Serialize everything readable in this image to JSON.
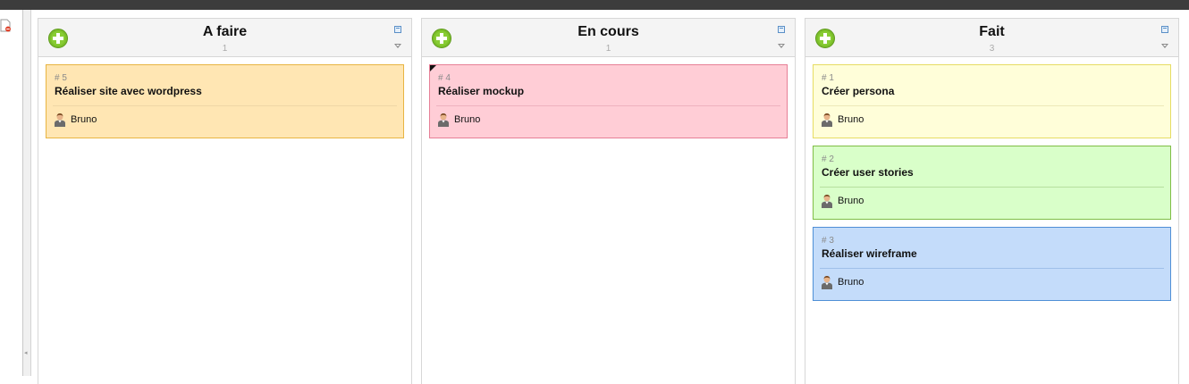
{
  "board": {
    "columns": [
      {
        "title": "A faire",
        "count": "1",
        "cards": [
          {
            "id": "# 5",
            "title": "Réaliser site avec wordpress",
            "assignee": "Bruno",
            "color": "#ffe6b3",
            "border": "#e8b442",
            "separator": "#efd7a6",
            "flagged": false
          }
        ]
      },
      {
        "title": "En cours",
        "count": "1",
        "cards": [
          {
            "id": "# 4",
            "title": "Réaliser mockup",
            "assignee": "Bruno",
            "color": "#ffcdd6",
            "border": "#e67f96",
            "separator": "#eeb2bf",
            "flagged": true
          }
        ]
      },
      {
        "title": "Fait",
        "count": "3",
        "cards": [
          {
            "id": "# 1",
            "title": "Créer persona",
            "assignee": "Bruno",
            "color": "#fffed9",
            "border": "#e6dc63",
            "separator": "#ece9b9",
            "flagged": false
          },
          {
            "id": "# 2",
            "title": "Créer user stories",
            "assignee": "Bruno",
            "color": "#d9ffc9",
            "border": "#7fbd45",
            "separator": "#b6df9e",
            "flagged": false
          },
          {
            "id": "# 3",
            "title": "Réaliser wireframe",
            "assignee": "Bruno",
            "color": "#c4dcfa",
            "border": "#4f8fd6",
            "separator": "#9fc0ea",
            "flagged": false
          }
        ]
      }
    ]
  },
  "icons": {
    "add": "add-card-icon",
    "maximize": "maximize-icon",
    "collapse": "collapse-icon",
    "user": "user-icon",
    "document": "document-icon"
  }
}
